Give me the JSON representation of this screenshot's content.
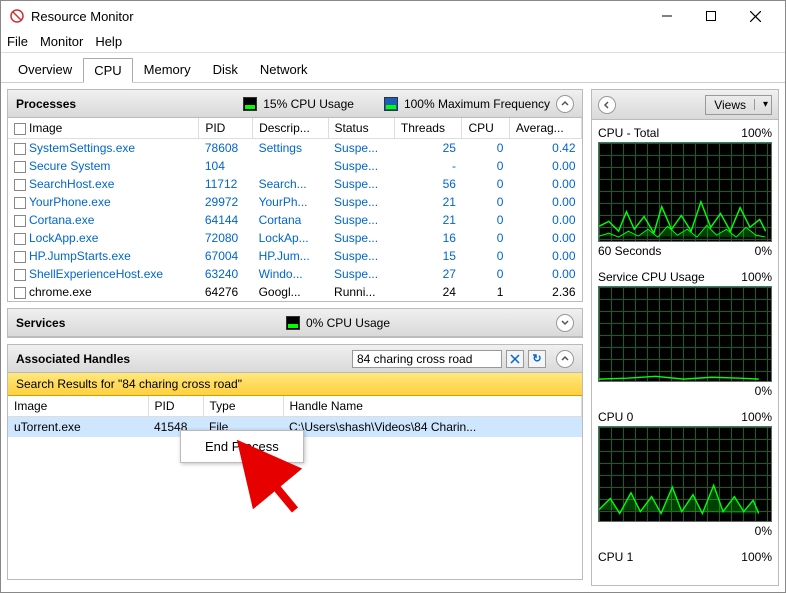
{
  "window": {
    "title": "Resource Monitor"
  },
  "menubar": {
    "file": "File",
    "monitor": "Monitor",
    "help": "Help"
  },
  "tabs": {
    "overview": "Overview",
    "cpu": "CPU",
    "memory": "Memory",
    "disk": "Disk",
    "network": "Network"
  },
  "processes": {
    "title": "Processes",
    "cpu_usage_label": "15% CPU Usage",
    "max_freq_label": "100% Maximum Frequency",
    "columns": {
      "image": "Image",
      "pid": "PID",
      "desc": "Descrip...",
      "status": "Status",
      "threads": "Threads",
      "cpu": "CPU",
      "avg": "Averag..."
    },
    "rows": [
      {
        "image": "SystemSettings.exe",
        "pid": "78608",
        "desc": "Settings",
        "status": "Suspe...",
        "threads": "25",
        "cpu": "0",
        "avg": "0.42",
        "blue": true
      },
      {
        "image": "Secure System",
        "pid": "104",
        "desc": "",
        "status": "Suspe...",
        "threads": "-",
        "cpu": "0",
        "avg": "0.00",
        "blue": true
      },
      {
        "image": "SearchHost.exe",
        "pid": "11712",
        "desc": "Search...",
        "status": "Suspe...",
        "threads": "56",
        "cpu": "0",
        "avg": "0.00",
        "blue": true
      },
      {
        "image": "YourPhone.exe",
        "pid": "29972",
        "desc": "YourPh...",
        "status": "Suspe...",
        "threads": "21",
        "cpu": "0",
        "avg": "0.00",
        "blue": true
      },
      {
        "image": "Cortana.exe",
        "pid": "64144",
        "desc": "Cortana",
        "status": "Suspe...",
        "threads": "21",
        "cpu": "0",
        "avg": "0.00",
        "blue": true
      },
      {
        "image": "LockApp.exe",
        "pid": "72080",
        "desc": "LockAp...",
        "status": "Suspe...",
        "threads": "16",
        "cpu": "0",
        "avg": "0.00",
        "blue": true
      },
      {
        "image": "HP.JumpStarts.exe",
        "pid": "67004",
        "desc": "HP.Jum...",
        "status": "Suspe...",
        "threads": "15",
        "cpu": "0",
        "avg": "0.00",
        "blue": true
      },
      {
        "image": "ShellExperienceHost.exe",
        "pid": "63240",
        "desc": "Windo...",
        "status": "Suspe...",
        "threads": "27",
        "cpu": "0",
        "avg": "0.00",
        "blue": true
      },
      {
        "image": "chrome.exe",
        "pid": "64276",
        "desc": "Googl...",
        "status": "Runni...",
        "threads": "24",
        "cpu": "1",
        "avg": "2.36",
        "blue": false
      }
    ]
  },
  "services": {
    "title": "Services",
    "cpu_usage_label": "0% CPU Usage"
  },
  "handles": {
    "title": "Associated Handles",
    "search_value": "84 charing cross road",
    "search_results_label": "Search Results for \"84 charing cross road\"",
    "columns": {
      "image": "Image",
      "pid": "PID",
      "type": "Type",
      "name": "Handle Name"
    },
    "row": {
      "image": "uTorrent.exe",
      "pid": "41548",
      "type": "File",
      "name": "C:\\Users\\shash\\Videos\\84 Charin..."
    }
  },
  "context_menu": {
    "end_process": "End Process"
  },
  "right": {
    "views": "Views",
    "cpu_total": {
      "label": "CPU - Total",
      "value": "100%"
    },
    "seconds": {
      "label": "60 Seconds",
      "value": "0%"
    },
    "service": {
      "label": "Service CPU Usage",
      "value": "100%"
    },
    "service_bottom": {
      "label": "",
      "value": "0%"
    },
    "cpu0": {
      "label": "CPU 0",
      "value": "100%"
    },
    "cpu0_bottom": {
      "label": "",
      "value": "0%"
    },
    "cpu1": {
      "label": "CPU 1",
      "value": "100%"
    }
  }
}
